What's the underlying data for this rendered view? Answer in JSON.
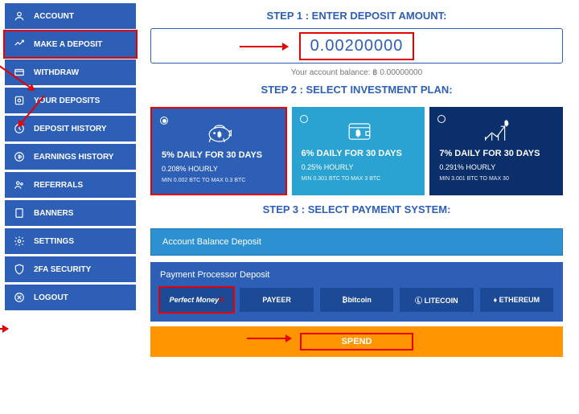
{
  "sidebar": {
    "items": [
      {
        "label": "ACCOUNT"
      },
      {
        "label": "MAKE A DEPOSIT"
      },
      {
        "label": "WITHDRAW"
      },
      {
        "label": "YOUR DEPOSITS"
      },
      {
        "label": "DEPOSIT HISTORY"
      },
      {
        "label": "EARNINGS HISTORY"
      },
      {
        "label": "REFERRALS"
      },
      {
        "label": "BANNERS"
      },
      {
        "label": "SETTINGS"
      },
      {
        "label": "2FA SECURITY"
      },
      {
        "label": "LOGOUT"
      }
    ]
  },
  "steps": {
    "s1": "STEP 1 : ENTER DEPOSIT AMOUNT:",
    "s2": "STEP 2 : SELECT INVESTMENT PLAN:",
    "s3": "STEP 3 : SELECT PAYMENT SYSTEM:"
  },
  "deposit": {
    "amount": "0.00200000",
    "balance_label": "Your account balance: ฿ 0.00000000"
  },
  "plans": [
    {
      "rate": "5% DAILY",
      "duration": " FOR 30 DAYS",
      "hourly": "0.208% HOURLY",
      "range": "MIN 0.002 BTC TO MAX 0.3 BTC"
    },
    {
      "rate": "6% DAILY",
      "duration": " FOR 30 DAYS",
      "hourly": "0.25% HOURLY",
      "range": "MIN 0.301 BTC TO MAX 3 BTC"
    },
    {
      "rate": "7% DAILY",
      "duration": " FOR 30 DAYS",
      "hourly": "0.291% HOURLY",
      "range": "MIN 3.001 BTC TO MAX 30"
    }
  ],
  "payment": {
    "balance_section": "Account Balance Deposit",
    "processor_section": "Payment Processor Deposit",
    "options": [
      {
        "label": "Perfect Money"
      },
      {
        "label": "PAYEER"
      },
      {
        "label": "bitcoin"
      },
      {
        "label": "LITECOIN"
      },
      {
        "label": "ETHEREUM"
      }
    ]
  },
  "spend": "SPEND"
}
